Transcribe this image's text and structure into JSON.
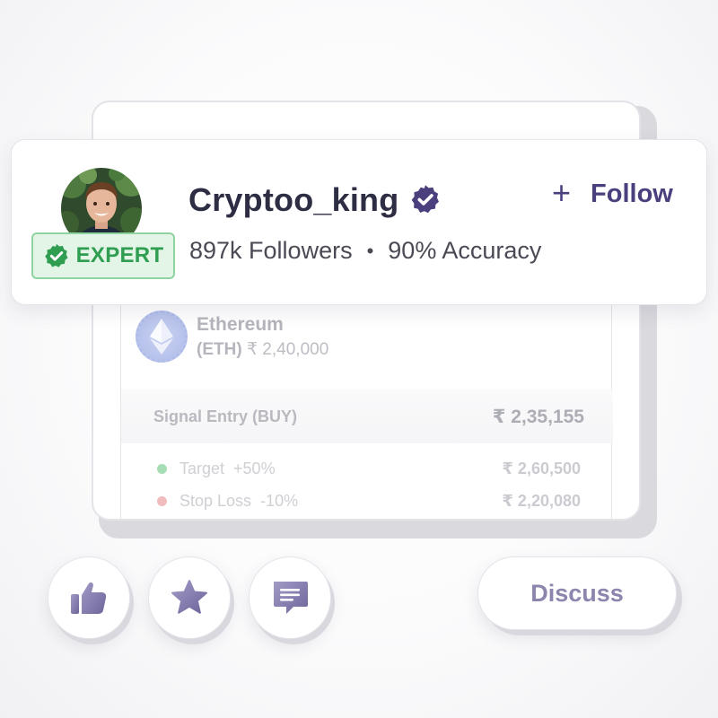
{
  "profile": {
    "username": "Cryptoo_king",
    "badge": "EXPERT",
    "followers": "897k Followers",
    "separator": "•",
    "accuracy": "90% Accuracy",
    "follow_label": "Follow",
    "follow_plus": "+"
  },
  "coin": {
    "name": "Ethereum",
    "ticker": "(ETH)",
    "price": "₹ 2,40,000"
  },
  "signal": {
    "entry_label": "Signal Entry (BUY)",
    "entry_value": "₹ 2,35,155",
    "levels": [
      {
        "label": "Target",
        "pct": "+50%",
        "value": "₹ 2,60,500",
        "color": "#a7ddb4"
      },
      {
        "label": "Stop Loss",
        "pct": "-10%",
        "value": "₹ 2,20,080",
        "color": "#f2bcbc"
      }
    ]
  },
  "actions": {
    "discuss_label": "Discuss"
  },
  "colors": {
    "brand": "#4b3f7e",
    "expert_green": "#2f9e51",
    "icon_purple": "#7e76a8"
  },
  "icons": [
    "thumbs-up-icon",
    "star-icon",
    "comment-icon",
    "verified-icon",
    "ethereum-icon"
  ]
}
